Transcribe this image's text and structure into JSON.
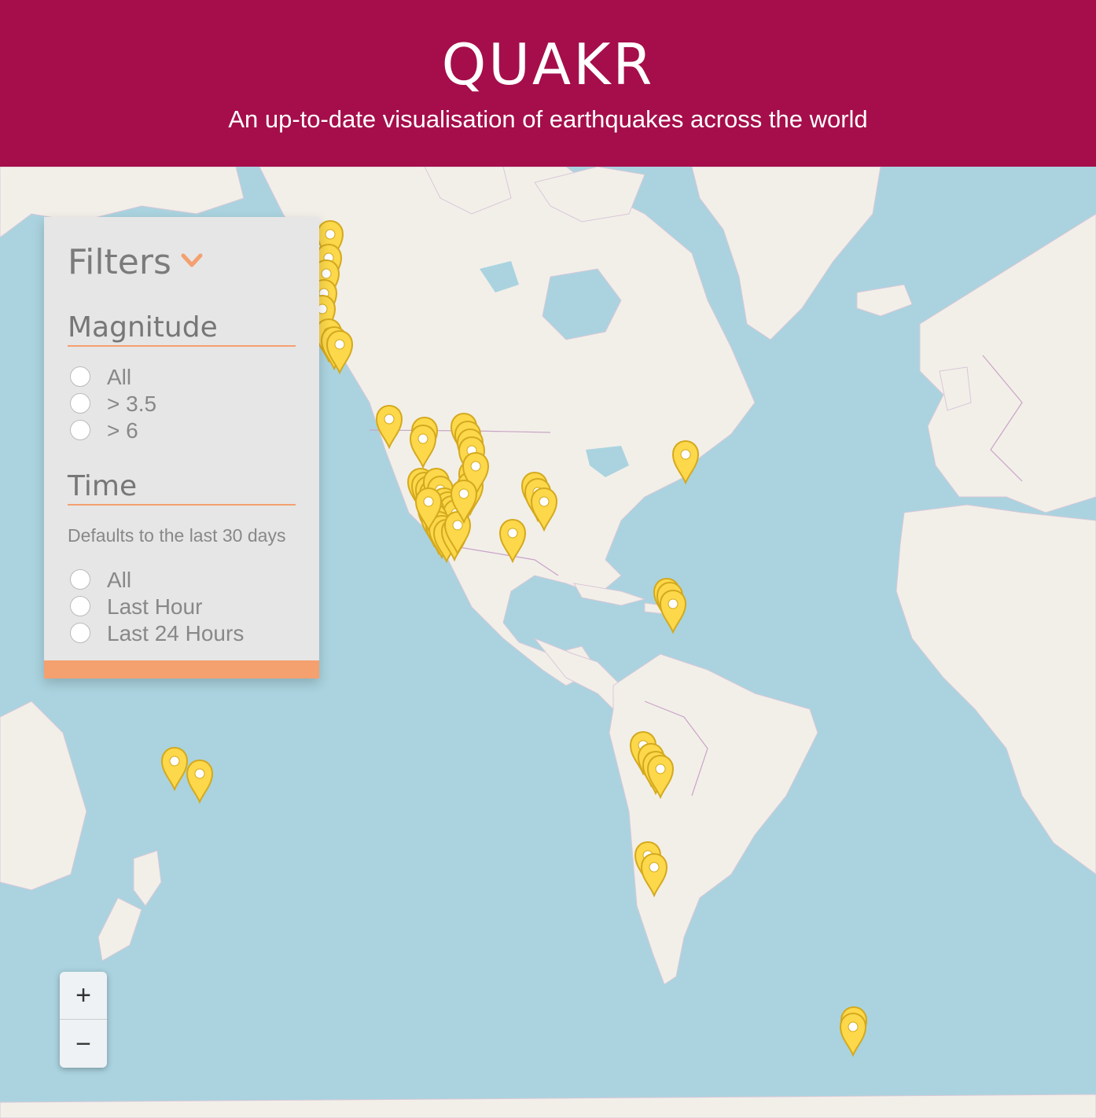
{
  "header": {
    "title": "QUAKR",
    "subtitle": "An up-to-date visualisation of earthquakes across the world"
  },
  "filters": {
    "title": "Filters",
    "magnitude": {
      "label": "Magnitude",
      "options": [
        "All",
        "> 3.5",
        "> 6"
      ]
    },
    "time": {
      "label": "Time",
      "note": "Defaults to the last 30 days",
      "options": [
        "All",
        "Last Hour",
        "Last 24 Hours"
      ]
    }
  },
  "zoom": {
    "in_label": "+",
    "out_label": "−"
  },
  "colors": {
    "header_bg": "#a50e4b",
    "accent": "#f4a06f",
    "marker": "#fcd84a",
    "ocean": "#aad3df",
    "land": "#f2efe9"
  },
  "map": {
    "marker_icon": "map-pin-icon",
    "marker_count": 60
  }
}
